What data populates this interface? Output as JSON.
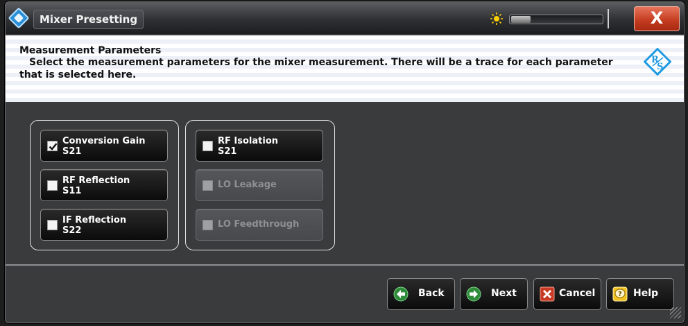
{
  "window": {
    "title": "Mixer Presetting",
    "close_label": "X"
  },
  "header": {
    "title": "Measurement Parameters",
    "description": "Select the measurement parameters for the mixer measurement. There will be a trace for each parameter that is selected here."
  },
  "params": {
    "conversion_gain": {
      "line1": "Conversion Gain",
      "line2": "S21",
      "checked": true,
      "enabled": true
    },
    "rf_reflection": {
      "line1": "RF Reflection",
      "line2": "S11",
      "checked": false,
      "enabled": true
    },
    "if_reflection": {
      "line1": "IF Reflection",
      "line2": "S22",
      "checked": false,
      "enabled": true
    },
    "rf_isolation": {
      "line1": "RF Isolation",
      "line2": "S21",
      "checked": false,
      "enabled": true
    },
    "lo_leakage": {
      "line1": "LO Leakage",
      "checked": false,
      "enabled": false
    },
    "lo_feedthrough": {
      "line1": "LO Feedthrough",
      "checked": false,
      "enabled": false
    }
  },
  "footer": {
    "back_label": "Back",
    "next_label": "Next",
    "cancel_label": "Cancel",
    "help_label": "Help"
  },
  "colors": {
    "accent_green": "#2e8b3a",
    "cancel_red": "#c83a24",
    "help_yellow": "#f0c020",
    "brand_blue": "#2a8fd6"
  }
}
